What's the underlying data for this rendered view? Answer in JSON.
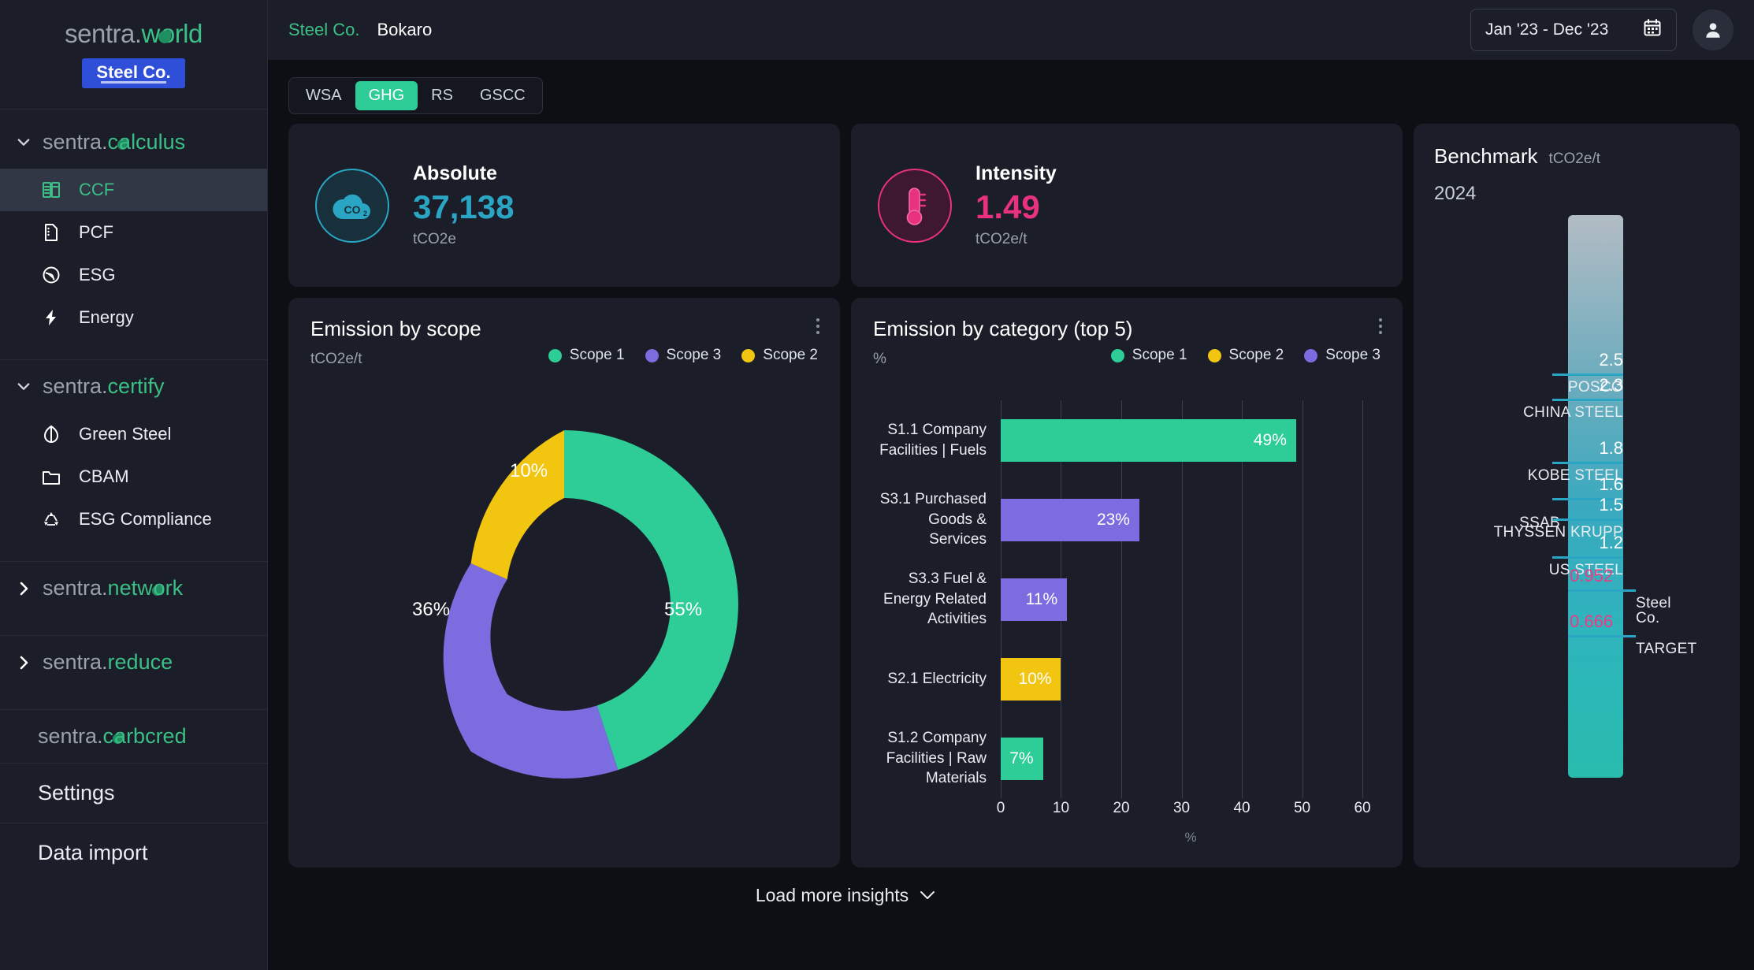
{
  "brand": {
    "name_dark": "sentra.",
    "name_green": "world",
    "tenant": "Steel Co."
  },
  "sidebar": {
    "groups": [
      {
        "name": "sentra.calculus",
        "prefix": "sentra.",
        "accent": "calculus",
        "expanded": true,
        "caret": "chevron-down-icon",
        "items": [
          {
            "label": "CCF",
            "icon": "building-grid-icon",
            "active": true
          },
          {
            "label": "PCF",
            "icon": "document-icon",
            "active": false
          },
          {
            "label": "ESG",
            "icon": "globe-icon",
            "active": false
          },
          {
            "label": "Energy",
            "icon": "bolt-icon",
            "active": false
          }
        ]
      },
      {
        "name": "sentra.certify",
        "prefix": "sentra.",
        "accent": "certify",
        "expanded": true,
        "caret": "chevron-down-icon",
        "items": [
          {
            "label": "Green Steel",
            "icon": "leaf-icon",
            "active": false
          },
          {
            "label": "CBAM",
            "icon": "folder-icon",
            "active": false
          },
          {
            "label": "ESG Compliance",
            "icon": "recycle-icon",
            "active": false
          }
        ]
      },
      {
        "name": "sentra.network",
        "prefix": "sentra.",
        "accent": "network",
        "expanded": false,
        "caret": "chevron-right-icon",
        "items": []
      },
      {
        "name": "sentra.reduce",
        "prefix": "sentra.",
        "accent": "reduce",
        "expanded": false,
        "caret": "chevron-right-icon",
        "items": []
      }
    ],
    "carbcred": {
      "prefix": "sentra.",
      "accent": "carbcred"
    },
    "plain_items": [
      {
        "label": "Settings"
      },
      {
        "label": "Data import"
      }
    ]
  },
  "topbar": {
    "company": "Steel Co.",
    "site": "Bokaro",
    "date_range": "Jan '23 - Dec '23",
    "calendar_icon": "calendar-icon",
    "avatar_icon": "user-avatar-icon"
  },
  "tabs": [
    {
      "label": "WSA",
      "active": false
    },
    {
      "label": "GHG",
      "active": true
    },
    {
      "label": "RS",
      "active": false
    },
    {
      "label": "GSCC",
      "active": false
    }
  ],
  "kpis": [
    {
      "title": "Absolute",
      "value": "37,138",
      "unit": "tCO2e",
      "icon": "co2-cloud-icon",
      "color": "#2aa6c4"
    },
    {
      "title": "Intensity",
      "value": "1.49",
      "unit": "tCO2e/t",
      "icon": "thermometer-icon",
      "color": "#e8327f"
    }
  ],
  "colors": {
    "scope1": "#2ecc97",
    "scope2": "#f2c511",
    "scope3": "#7b6ce0",
    "accent_green": "#3bbf86",
    "cyan": "#2aa6c4",
    "pink": "#e8327f"
  },
  "footer": {
    "load_more": "Load more insights",
    "caret_icon": "chevron-down-icon"
  },
  "chart_data": [
    {
      "type": "pie",
      "id": "emission-by-scope",
      "title": "Emission by scope",
      "subtitle": "tCO2e/t",
      "unit": "tCO2e/t",
      "legend_position": "top-right",
      "legend": [
        "Scope 1",
        "Scope 3",
        "Scope 2"
      ],
      "categories": [
        "Scope 1",
        "Scope 3",
        "Scope 2"
      ],
      "values": [
        55,
        36,
        10
      ],
      "labels": [
        "55%",
        "36%",
        "10%"
      ],
      "colors": [
        "#2ecc97",
        "#7b6ce0",
        "#f2c511"
      ],
      "donut": true,
      "menu_icon": "kebab-menu-icon"
    },
    {
      "type": "bar",
      "id": "emission-by-category",
      "orientation": "horizontal",
      "title": "Emission by category (top 5)",
      "subtitle": "%",
      "xlabel": "%",
      "ylabel": "",
      "legend_position": "top-right",
      "legend": [
        "Scope 1",
        "Scope 2",
        "Scope 3"
      ],
      "legend_colors": [
        "#2ecc97",
        "#f2c511",
        "#7b6ce0"
      ],
      "categories": [
        "S1.1 Company Facilities | Fuels",
        "S3.1 Purchased Goods & Services",
        "S3.3 Fuel & Energy Related Activities",
        "S2.1 Electricity",
        "S1.2 Company Facilities | Raw Materials"
      ],
      "values": [
        49,
        23,
        11,
        10,
        7
      ],
      "labels": [
        "49%",
        "23%",
        "11%",
        "10%",
        "7%"
      ],
      "bar_colors": [
        "#2ecc97",
        "#7b6ce0",
        "#7b6ce0",
        "#f2c511",
        "#2ecc97"
      ],
      "xlim": [
        0,
        63
      ],
      "xticks": [
        0,
        10,
        20,
        30,
        40,
        50,
        60
      ],
      "grid": true,
      "menu_icon": "kebab-menu-icon"
    },
    {
      "type": "bar",
      "id": "benchmark",
      "title": "Benchmark",
      "unit": "tCO2e/t",
      "year": "2024",
      "ylim": [
        0,
        2.9
      ],
      "markers": [
        {
          "name": "POSCO",
          "value": "2.5",
          "num": 2.5,
          "side": "left"
        },
        {
          "name": "CHINA STEEL",
          "value": "2.3",
          "num": 2.3,
          "side": "left"
        },
        {
          "name": "KOBE STEEL",
          "value": "1.8",
          "num": 1.8,
          "side": "left"
        },
        {
          "name": "SSAB",
          "value": "1.6",
          "num": 1.6,
          "side": "left"
        },
        {
          "name": "THYSSEN KRUPP",
          "value": "1.5",
          "num": 1.5,
          "side": "left"
        },
        {
          "name": "US STEEL",
          "value": "1.2",
          "num": 1.2,
          "side": "left"
        },
        {
          "name": "Steel Co.",
          "value": "0.952",
          "num": 0.952,
          "side": "right"
        },
        {
          "name": "TARGET",
          "value": "0.666",
          "num": 0.666,
          "side": "right"
        }
      ]
    }
  ]
}
